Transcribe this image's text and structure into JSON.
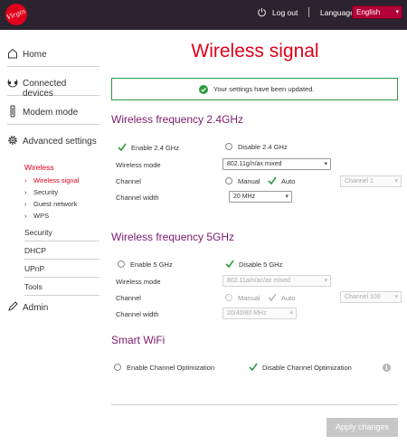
{
  "header": {
    "logo_text": "Virgin",
    "logout_label": "Log out",
    "language_label": "Language",
    "language_value": "English"
  },
  "sidebar": {
    "items": [
      {
        "label": "Home",
        "icon": "home-icon"
      },
      {
        "label": "Connected devices",
        "icon": "devices-icon"
      },
      {
        "label": "Modem mode",
        "icon": "modem-icon"
      },
      {
        "label": "Advanced settings",
        "icon": "gear-icon"
      },
      {
        "label": "Admin",
        "icon": "pencil-icon"
      }
    ],
    "wireless_label": "Wireless",
    "wireless_sub": [
      "Wireless signal",
      "Security",
      "Guest network",
      "WPS"
    ],
    "sections": [
      "Security",
      "DHCP",
      "UPnP",
      "Tools"
    ]
  },
  "main": {
    "title": "Wireless signal",
    "alert": "Your settings have been updated.",
    "band24": {
      "title": "Wireless frequency 2.4GHz",
      "enable_label": "Enable 2.4 GHz",
      "disable_label": "Disable 2.4 GHz",
      "mode_label": "Wireless mode",
      "mode_value": "802.11g/n/ax mixed",
      "channel_label": "Channel",
      "manual_label": "Manual",
      "auto_label": "Auto",
      "channel_value": "Channel 1",
      "width_label": "Channel width",
      "width_value": "20 MHz"
    },
    "band5": {
      "title": "Wireless frequency 5GHz",
      "enable_label": "Enable 5 GHz",
      "disable_label": "Disable 5 GHz",
      "mode_label": "Wireless mode",
      "mode_value": "802.11a/n/ac/ax mixed",
      "channel_label": "Channel",
      "manual_label": "Manual",
      "auto_label": "Auto",
      "channel_value": "Channel 100",
      "width_label": "Channel width",
      "width_value": "20/40/80 MHz"
    },
    "smartwifi": {
      "title": "Smart WiFi",
      "enable_label": "Enable Channel Optimization",
      "disable_label": "Disable Channel Optimization",
      "info_icon": "i"
    },
    "apply_label": "Apply changes"
  },
  "colors": {
    "brand_red": "#e0001b",
    "section_purple": "#7a1b6e",
    "header_bg": "#2b2430",
    "success_green": "#2e9a3e"
  }
}
